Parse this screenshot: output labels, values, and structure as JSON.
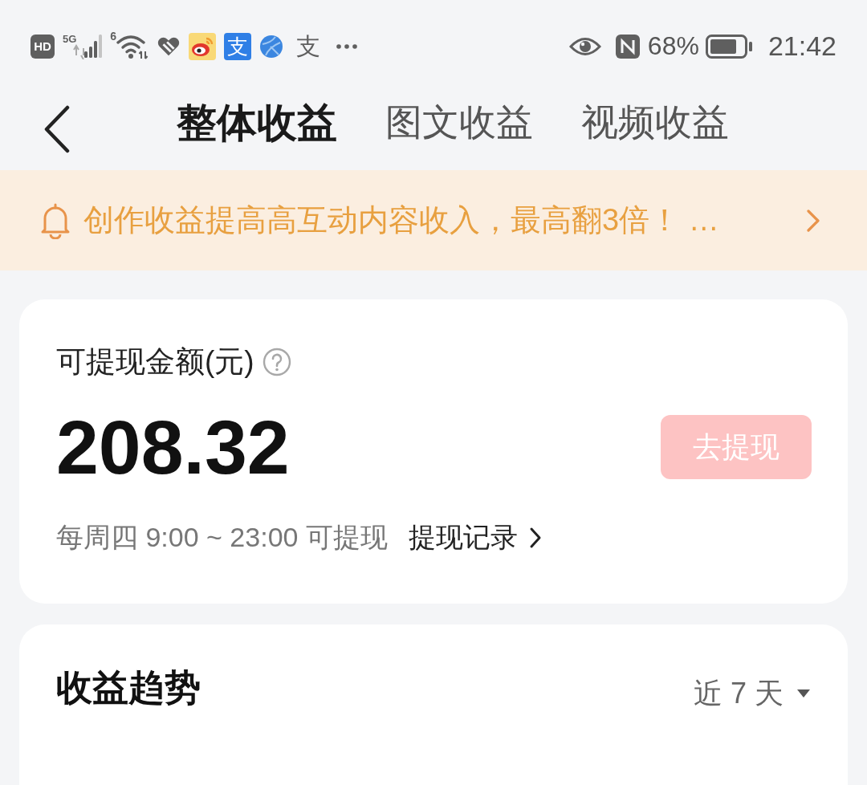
{
  "status_bar": {
    "hd_badge": "HD",
    "network_type": "5G",
    "wifi_generation": "6",
    "app_tile": "支",
    "app_glyph": "支",
    "battery_percent": "68%",
    "time": "21:42"
  },
  "tabs": [
    {
      "label": "整体收益",
      "selected": true
    },
    {
      "label": "图文收益",
      "selected": false
    },
    {
      "label": "视频收益",
      "selected": false
    }
  ],
  "notice": {
    "text": "创作收益提高高互动内容收入，最高翻3倍！ …"
  },
  "balance_card": {
    "label": "可提现金额(元)",
    "amount": "208.32",
    "withdraw_button": {
      "label": "去提现",
      "disabled": true
    },
    "schedule": "每周四 9:00 ~ 23:00 可提现",
    "history_link": "提现记录"
  },
  "trend_card": {
    "title": "收益趋势",
    "range": "近 7 天"
  }
}
